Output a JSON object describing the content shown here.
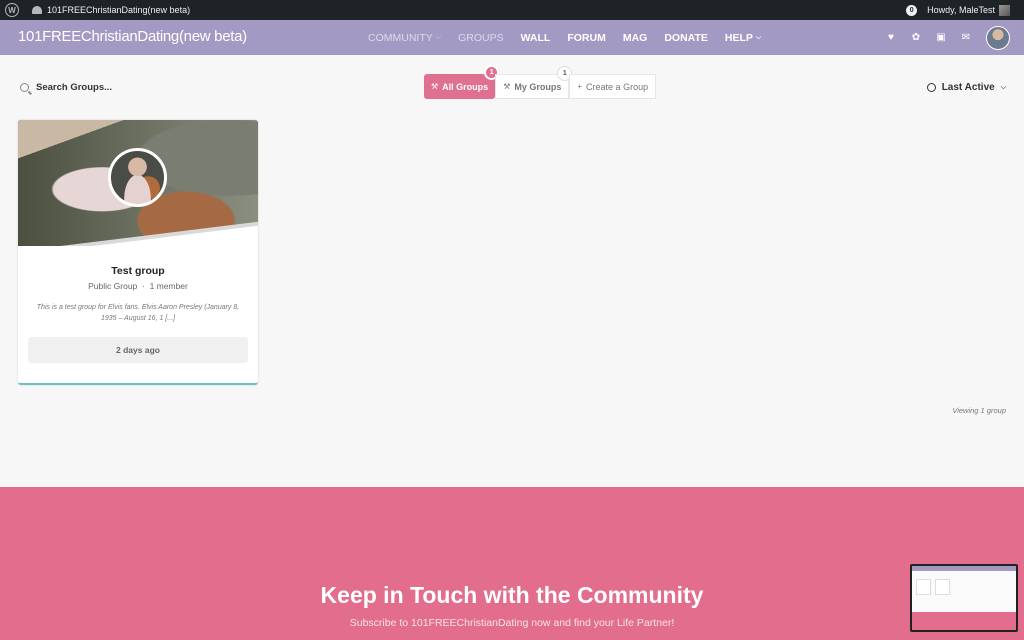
{
  "adminbar": {
    "site_name": "101FREEChristianDating(new beta)",
    "notifications": "0",
    "greeting": "Howdy, MaleTest"
  },
  "header": {
    "brand": "101FREEChristianDating(new beta)",
    "nav": [
      {
        "label": "COMMUNITY",
        "dropdown": true
      },
      {
        "label": "GROUPS",
        "dropdown": false
      },
      {
        "label": "WALL",
        "dropdown": false
      },
      {
        "label": "FORUM",
        "dropdown": false
      },
      {
        "label": "MAG",
        "dropdown": false
      },
      {
        "label": "DONATE",
        "dropdown": false
      },
      {
        "label": "HELP",
        "dropdown": true
      }
    ],
    "icons": [
      "heart-icon",
      "paw-icon",
      "chat-icon",
      "envelope-icon"
    ]
  },
  "toolbar": {
    "search_placeholder": "Search Groups...",
    "tabs": [
      {
        "label": "All Groups",
        "count": "1",
        "active": true
      },
      {
        "label": "My Groups",
        "count": "1",
        "active": false
      },
      {
        "label": "Create a Group",
        "count": null,
        "active": false
      }
    ],
    "sort_label": "Last Active"
  },
  "groups": [
    {
      "title": "Test group",
      "type": "Public Group",
      "members": "1 member",
      "description": "This is a test group for Elvis fans. Elvis Aaron Presley (January 8, 1935 – August 16, 1 [...]",
      "last_active": "2 days ago"
    }
  ],
  "viewing": "Viewing 1 group",
  "footer": {
    "heading": "Keep in Touch with the Community",
    "subheading": "Subscribe to 101FREEChristianDating now and find your Life Partner!"
  },
  "colors": {
    "header_bg": "#a39ac4",
    "accent": "#e07090",
    "footer_bg": "#e26d8c",
    "card_border": "#6bc3bf"
  }
}
